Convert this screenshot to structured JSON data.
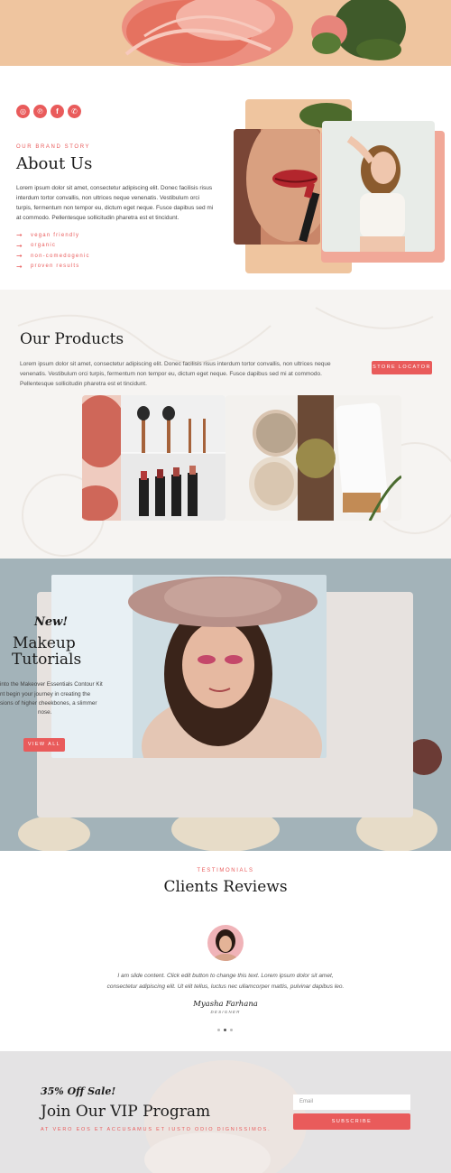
{
  "about": {
    "social_icons": [
      "instagram-icon",
      "pinterest-icon",
      "facebook-icon",
      "whatsapp-icon"
    ],
    "eyebrow": "OUR BRAND STORY",
    "title": "About Us",
    "body": "Lorem ipsum dolor sit amet, consectetur adipiscing elit. Donec facilisis risus interdum tortor convallis, non ultrices neque venenatis. Vestibulum orci turpis, fermentum non tempor eu, dictum eget neque. Fusce dapibus sed mi at commodo. Pellentesque sollicitudin pharetra est et tincidunt.",
    "features": [
      "vegan friendly",
      "organic",
      "non-comedogenic",
      "proven results"
    ]
  },
  "products": {
    "title": "Our Products",
    "body": "Lorem ipsum dolor sit amet, consectetur adipiscing elit. Donec facilisis risus interdum tortor convallis, non ultrices neque venenatis. Vestibulum orci turpis, fermentum non tempor eu, dictum eget neque. Fusce dapibus sed mi at commodo. Pellentesque sollicitudin pharetra est et tincidunt.",
    "button": "STORE LOCATOR"
  },
  "tutorials": {
    "script": "New!",
    "title_line1": "Makeup",
    "title_line2": "Tutorials",
    "body_line1": "into the Makeover Essentials Contour Kit",
    "body_line2": "nt begin your journey in creating the",
    "body_line3": "sions of higher cheekbones, a slimmer",
    "body_line4": "nose.",
    "button": "VIEW ALL"
  },
  "reviews": {
    "eyebrow": "TESTIMONIALS",
    "title": "Clients Reviews",
    "quote_line1": "I am slide content. Click edit button to change this text. Lorem ipsum dolor sit amet,",
    "quote_line2": "consectetur adipiscing elit. Ut elit tellus, luctus nec ullamcorper mattis, pulvinar dapibus leo.",
    "name": "Myasha Farhana",
    "role": "DESIGNER"
  },
  "vip": {
    "script": "35% Off Sale!",
    "title": "Join Our VIP Program",
    "subtitle": "AT VERO EOS ET ACCUSAMUS ET IUSTO ODIO DIGNISSIMOS.",
    "email_placeholder": "Email",
    "button": "SUBSCRIBE"
  },
  "colors": {
    "accent": "#e95b5b",
    "peach": "#efc59f",
    "sage": "#a3b3b9"
  }
}
